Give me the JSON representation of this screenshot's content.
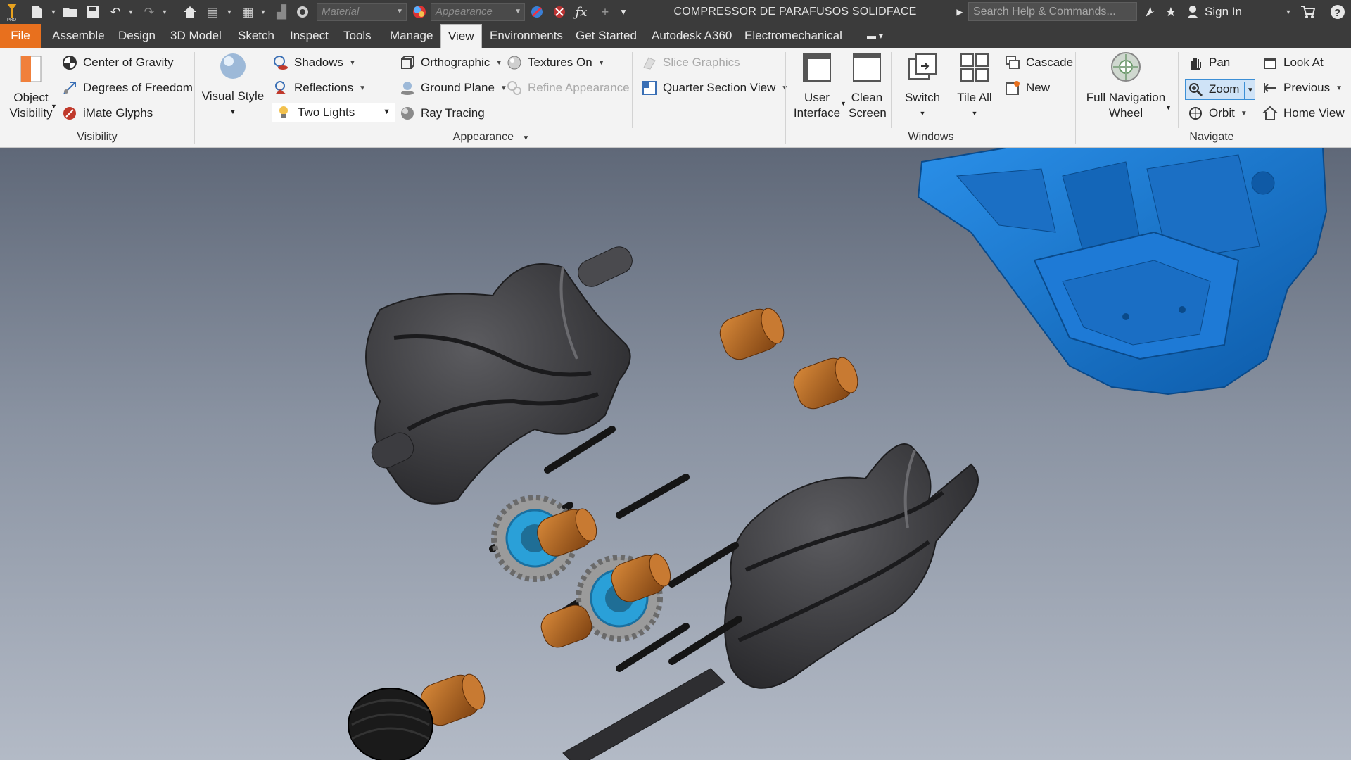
{
  "titlebar": {
    "title": "COMPRESSOR DE PARAFUSOS SOLIDFACE",
    "material_placeholder": "Material",
    "appearance_placeholder": "Appearance",
    "search_placeholder": "Search Help & Commands...",
    "sign_in": "Sign In"
  },
  "tabs": {
    "file": "File",
    "assemble": "Assemble",
    "design": "Design",
    "model3d": "3D Model",
    "sketch": "Sketch",
    "inspect": "Inspect",
    "tools": "Tools",
    "manage": "Manage",
    "view": "View",
    "environments": "Environments",
    "get_started": "Get Started",
    "a360": "Autodesk A360",
    "electromechanical": "Electromechanical"
  },
  "ribbon": {
    "visibility": {
      "object_visibility": [
        "Object",
        "Visibility"
      ],
      "center_of_gravity": "Center of Gravity",
      "degrees_of_freedom": "Degrees of Freedom",
      "imate_glyphs": "iMate Glyphs",
      "label": "Visibility"
    },
    "appearance": {
      "visual_style": "Visual Style",
      "shadows": "Shadows",
      "reflections": "Reflections",
      "lighting": "Two Lights",
      "orthographic": "Orthographic",
      "ground_plane": "Ground Plane",
      "ray_tracing": "Ray Tracing",
      "textures_on": "Textures On",
      "refine_appearance": "Refine Appearance",
      "slice_graphics": "Slice Graphics",
      "quarter_section_view": "Quarter Section View",
      "label": "Appearance"
    },
    "windows": {
      "user_interface": [
        "User",
        "Interface"
      ],
      "clean_screen": [
        "Clean",
        "Screen"
      ],
      "switch": "Switch",
      "tile_all": "Tile All",
      "cascade": "Cascade",
      "new": "New",
      "label": "Windows"
    },
    "navigate": {
      "full_navigation_wheel": [
        "Full Navigation",
        "Wheel"
      ],
      "pan": "Pan",
      "zoom": "Zoom",
      "orbit": "Orbit",
      "look_at": "Look At",
      "previous": "Previous",
      "home_view": "Home View",
      "label": "Navigate"
    }
  },
  "colors": {
    "file_tab": "#e8701e",
    "housing_blue": "#1a78d4",
    "rotor": "#3a3a3d",
    "bushing": "#b5651d",
    "gear": "#9a9a9a",
    "seal_blue": "#2aa0d8"
  }
}
